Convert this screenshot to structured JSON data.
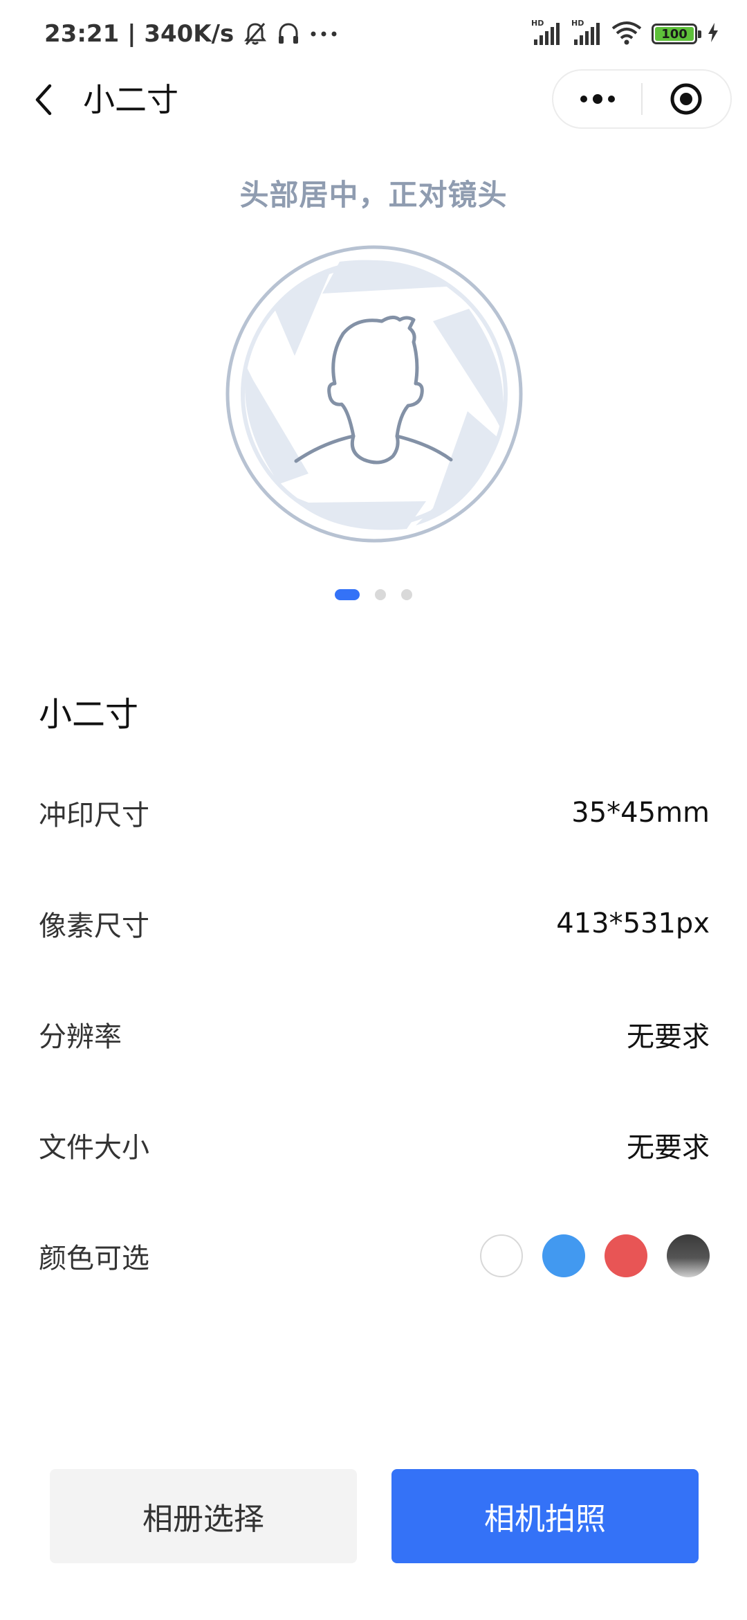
{
  "status_bar": {
    "time_speed": "23:21 | 340K/s",
    "network_badges": [
      "HD",
      "HD"
    ],
    "battery_level": "100"
  },
  "nav": {
    "title": "小二寸"
  },
  "hint": "头部居中，正对镜头",
  "carousel": {
    "page_count": 3,
    "active_index": 0
  },
  "spec": {
    "title": "小二寸",
    "rows": [
      {
        "label": "冲印尺寸",
        "value": "35*45mm"
      },
      {
        "label": "像素尺寸",
        "value": "413*531px"
      },
      {
        "label": "分辨率",
        "value": "无要求"
      },
      {
        "label": "文件大小",
        "value": "无要求"
      }
    ],
    "color_label": "颜色可选",
    "colors": [
      {
        "name": "white",
        "hex": "#ffffff"
      },
      {
        "name": "blue",
        "hex": "#4299f0"
      },
      {
        "name": "red",
        "hex": "#e85555"
      },
      {
        "name": "gradient-gray",
        "hex": "#555555"
      }
    ]
  },
  "buttons": {
    "album": "相册选择",
    "camera": "相机拍照"
  },
  "theme": {
    "accent": "#3472f7",
    "hint_color": "#8f9cb0"
  }
}
